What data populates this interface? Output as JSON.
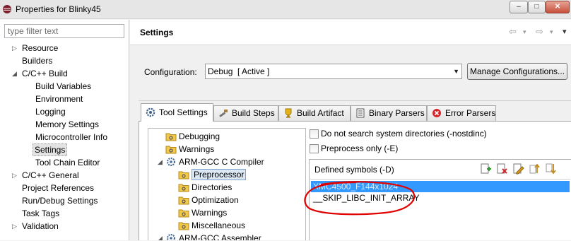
{
  "window": {
    "title": "Properties for Blinky45",
    "controls": [
      "–",
      "□",
      "✕"
    ]
  },
  "sidebar": {
    "filter_placeholder": "type filter text",
    "items": [
      {
        "label": "Resource",
        "twisty": "▷"
      },
      {
        "label": "Builders",
        "twisty": ""
      },
      {
        "label": "C/C++ Build",
        "twisty": "◢"
      },
      {
        "label": "Build Variables",
        "twisty": ""
      },
      {
        "label": "Environment",
        "twisty": ""
      },
      {
        "label": "Logging",
        "twisty": ""
      },
      {
        "label": "Memory Settings",
        "twisty": ""
      },
      {
        "label": "Microcontroller Info",
        "twisty": ""
      },
      {
        "label": "Settings",
        "twisty": ""
      },
      {
        "label": "Tool Chain Editor",
        "twisty": ""
      },
      {
        "label": "C/C++ General",
        "twisty": "▷"
      },
      {
        "label": "Project References",
        "twisty": ""
      },
      {
        "label": "Run/Debug Settings",
        "twisty": ""
      },
      {
        "label": "Task Tags",
        "twisty": ""
      },
      {
        "label": "Validation",
        "twisty": "▷"
      }
    ],
    "selected": "Settings"
  },
  "header": {
    "title": "Settings",
    "nav_glyphs": [
      "⇦",
      "▾",
      "⇨",
      "▾",
      "▾"
    ]
  },
  "configuration": {
    "label": "Configuration:",
    "value": "Debug  [ Active ]",
    "arrow": "▼",
    "manage_label": "Manage Configurations..."
  },
  "tabs": [
    {
      "label": "Tool Settings",
      "icon": "tool-settings-icon",
      "active": true
    },
    {
      "label": "Build Steps",
      "icon": "build-steps-icon",
      "active": false
    },
    {
      "label": "Build Artifact",
      "icon": "build-artifact-icon",
      "active": false
    },
    {
      "label": "Binary Parsers",
      "icon": "binary-parsers-icon",
      "active": false
    },
    {
      "label": "Error Parsers",
      "icon": "error-parsers-icon",
      "active": false
    }
  ],
  "tool_tree": {
    "items": [
      {
        "label": "Debugging",
        "icon": "folder-tool-icon"
      },
      {
        "label": "Warnings",
        "icon": "folder-tool-icon"
      },
      {
        "label": "ARM-GCC C Compiler",
        "icon": "gear-icon",
        "twisty": "◢"
      },
      {
        "label": "Preprocessor",
        "icon": "folder-tool-icon",
        "selected": true
      },
      {
        "label": "Directories",
        "icon": "folder-tool-icon"
      },
      {
        "label": "Optimization",
        "icon": "folder-tool-icon"
      },
      {
        "label": "Warnings",
        "icon": "folder-tool-icon"
      },
      {
        "label": "Miscellaneous",
        "icon": "folder-tool-icon"
      },
      {
        "label": "ARM-GCC Assembler",
        "icon": "gear-icon",
        "twisty": "◢"
      }
    ]
  },
  "options": {
    "nostdinc_label": "Do not search system directories (-nostdinc)",
    "nostdinc_checked": false,
    "preprocess_label": "Preprocess only (-E)",
    "preprocess_checked": false
  },
  "defined_symbols": {
    "title": "Defined symbols (-D)",
    "toolbar_icons": [
      "add-icon",
      "delete-icon",
      "edit-icon",
      "move-up-icon",
      "move-down-icon"
    ],
    "items": [
      {
        "label": "XMC4500_F144x1024",
        "selected": true
      },
      {
        "label": "__SKIP_LIBC_INIT_ARRAY",
        "selected": false
      }
    ]
  },
  "colors": {
    "selection": "#3399ff",
    "annotation": "#e00000"
  }
}
